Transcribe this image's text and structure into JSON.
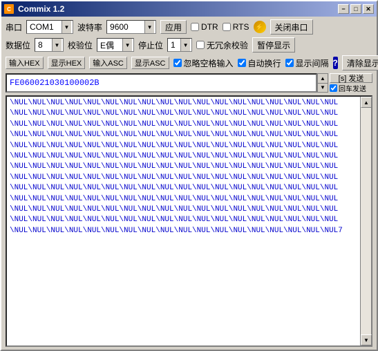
{
  "window": {
    "title": "Commix 1.2",
    "min_label": "−",
    "max_label": "□",
    "close_label": "✕"
  },
  "row1": {
    "port_label": "串口",
    "port_value": "COM1",
    "baud_label": "波特率",
    "baud_value": "9600",
    "apply_label": "应用",
    "dtr_label": "DTR",
    "rts_label": "RTS",
    "close_port_label": "关闭串口"
  },
  "row2": {
    "data_bits_label": "数据位",
    "data_bits_value": "8",
    "parity_label": "校验位",
    "parity_value": "E偶",
    "stop_label": "停止位",
    "stop_value": "1",
    "no_extra_check_label": "无冗余校验",
    "pause_display_label": "暂停显示"
  },
  "row3": {
    "input_hex_label": "输入HEX",
    "show_hex_label": "显示HEX",
    "input_asc_label": "输入ASC",
    "show_asc_label": "显示ASC",
    "ignore_space_label": "忽略空格输入",
    "auto_wrap_label": "自动换行",
    "show_interval_label": "显示间隔",
    "clear_display_label": "清除显示"
  },
  "input_field": {
    "value": "FE060021030100002B"
  },
  "send": {
    "send_label": "[s] 发送",
    "carriage_return_label": "回车发送"
  },
  "output": {
    "lines": [
      "\\NUL\\NUL\\NUL\\NUL\\NUL\\NUL\\NUL\\NUL\\NUL\\NUL\\NUL\\NUL\\NUL\\NUL\\NUL\\NUL\\NUL\\NUL",
      "\\NUL\\NUL\\NUL\\NUL\\NUL\\NUL\\NUL\\NUL\\NUL\\NUL\\NUL\\NUL\\NUL\\NUL\\NUL\\NUL\\NUL\\NUL",
      "\\NUL\\NUL\\NUL\\NUL\\NUL\\NUL\\NUL\\NUL\\NUL\\NUL\\NUL\\NUL\\NUL\\NUL\\NUL\\NUL\\NUL\\NUL",
      "\\NUL\\NUL\\NUL\\NUL\\NUL\\NUL\\NUL\\NUL\\NUL\\NUL\\NUL\\NUL\\NUL\\NUL\\NUL\\NUL\\NUL\\NUL",
      "\\NUL\\NUL\\NUL\\NUL\\NUL\\NUL\\NUL\\NUL\\NUL\\NUL\\NUL\\NUL\\NUL\\NUL\\NUL\\NUL\\NUL\\NUL",
      "\\NUL\\NUL\\NUL\\NUL\\NUL\\NUL\\NUL\\NUL\\NUL\\NUL\\NUL\\NUL\\NUL\\NUL\\NUL\\NUL\\NUL\\NUL",
      "\\NUL\\NUL\\NUL\\NUL\\NUL\\NUL\\NUL\\NUL\\NUL\\NUL\\NUL\\NUL\\NUL\\NUL\\NUL\\NUL\\NUL\\NUL",
      "\\NUL\\NUL\\NUL\\NUL\\NUL\\NUL\\NUL\\NUL\\NUL\\NUL\\NUL\\NUL\\NUL\\NUL\\NUL\\NUL\\NUL\\NUL",
      "\\NUL\\NUL\\NUL\\NUL\\NUL\\NUL\\NUL\\NUL\\NUL\\NUL\\NUL\\NUL\\NUL\\NUL\\NUL\\NUL\\NUL\\NUL",
      "\\NUL\\NUL\\NUL\\NUL\\NUL\\NUL\\NUL\\NUL\\NUL\\NUL\\NUL\\NUL\\NUL\\NUL\\NUL\\NUL\\NUL\\NUL",
      "\\NUL\\NUL\\NUL\\NUL\\NUL\\NUL\\NUL\\NUL\\NUL\\NUL\\NUL\\NUL\\NUL\\NUL\\NUL\\NUL\\NUL\\NUL",
      "\\NUL\\NUL\\NUL\\NUL\\NUL\\NUL\\NUL\\NUL\\NUL\\NUL\\NUL\\NUL\\NUL\\NUL\\NUL\\NUL\\NUL\\NUL",
      "\\NUL\\NUL\\NUL\\NUL\\NUL\\NUL\\NUL\\NUL\\NUL\\NUL\\NUL\\NUL\\NUL\\NUL\\NUL\\NUL\\NUL\\NUL7"
    ]
  }
}
